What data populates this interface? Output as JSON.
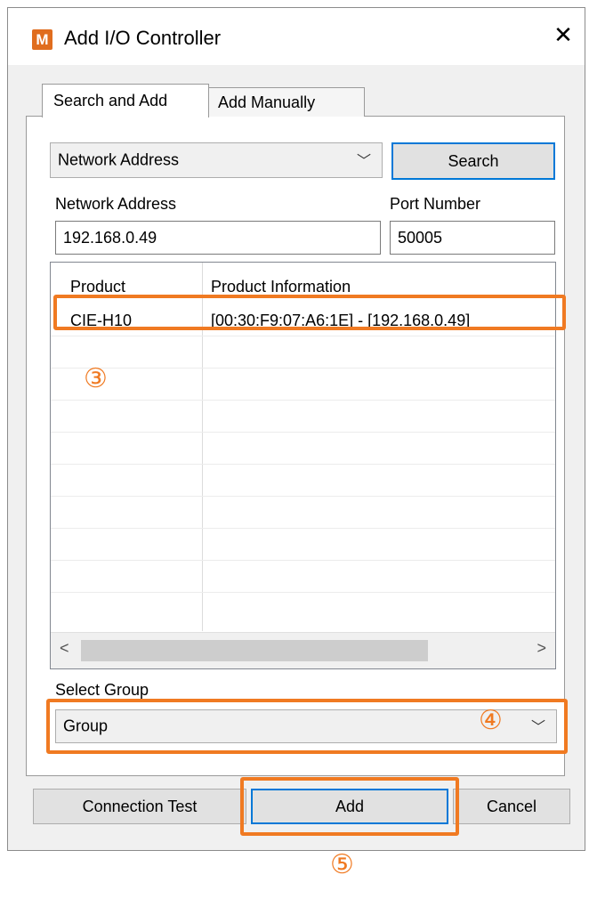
{
  "window": {
    "title": "Add I/O Controller",
    "icon_text": "M",
    "close_glyph": "✕"
  },
  "tabs": [
    {
      "label": "Search and Add",
      "active": true
    },
    {
      "label": "Add Manually",
      "active": false
    }
  ],
  "search": {
    "mode_value": "Network Address",
    "search_button": "Search",
    "address_label": "Network Address",
    "address_value": "192.168.0.49",
    "port_label": "Port Number",
    "port_value": "50005"
  },
  "results": {
    "columns": [
      "Product",
      "Product Information"
    ],
    "rows": [
      {
        "product": "CIE-H10",
        "info": "[00:30:F9:07:A6:1E] - [192.168.0.49]"
      }
    ]
  },
  "group": {
    "label": "Select Group",
    "value": "Group"
  },
  "footer": {
    "connection_test": "Connection Test",
    "add": "Add",
    "cancel": "Cancel"
  },
  "annotations": {
    "step3": "③",
    "step4": "④",
    "step5": "⑤"
  },
  "colors": {
    "callout": "#f07a22",
    "focus_border": "#0078d7",
    "app_icon": "#e06d1e"
  }
}
